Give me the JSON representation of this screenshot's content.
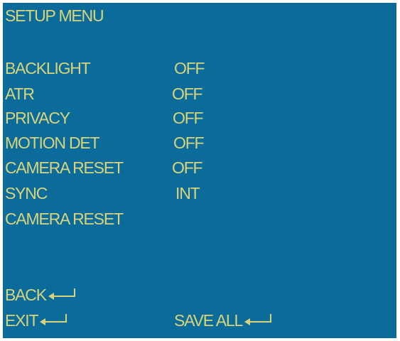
{
  "title": "SETUP MENU",
  "items": [
    {
      "label": "BACKLIGHT",
      "value": "OFF"
    },
    {
      "label": "ATR",
      "value": "OFF"
    },
    {
      "label": "PRIVACY",
      "value": "OFF"
    },
    {
      "label": "MOTION DET",
      "value": "OFF"
    },
    {
      "label": "CAMERA RESET",
      "value": "OFF"
    },
    {
      "label": "SYNC",
      "value": "INT"
    },
    {
      "label": "CAMERA RESET",
      "value": ""
    }
  ],
  "actions": {
    "back": "BACK",
    "exit": "EXIT",
    "save_all": "SAVE ALL"
  },
  "icons": {
    "enter": "enter-arrow-icon"
  },
  "colors": {
    "background": "#0b6c9b",
    "text": "#d8d47a"
  }
}
